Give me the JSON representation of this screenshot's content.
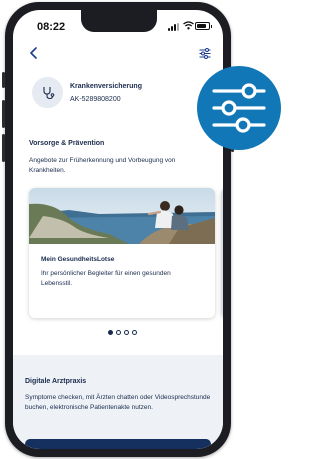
{
  "status": {
    "time": "08:22"
  },
  "nav": {
    "back_icon": "chevron-left-icon",
    "filter_icon": "sliders-icon"
  },
  "insurance": {
    "title": "Krankenversicherung",
    "number": "AK-5289808200",
    "icon": "stethoscope-icon"
  },
  "prevention": {
    "title": "Vorsorge & Prävention",
    "description": "Angebote zur Früherkennung und Vorbeugung von Krankheiten.",
    "card": {
      "title": "Mein GesundheitsLotse",
      "description": "Ihr persönlicher Begleiter für einen gesunden Lebensstil."
    },
    "pagination": {
      "total": 4,
      "active": 1
    }
  },
  "practice": {
    "title": "Digitale Arztpraxis",
    "description": "Symptome checken, mit Ärzten chatten oder Videosprechstunde buchen, elektronische Patientenakte nutzen."
  },
  "colors": {
    "accent": "#1277b6",
    "navy": "#15305f",
    "text": "#1a2b4c",
    "section_bg": "#eef2f7"
  }
}
